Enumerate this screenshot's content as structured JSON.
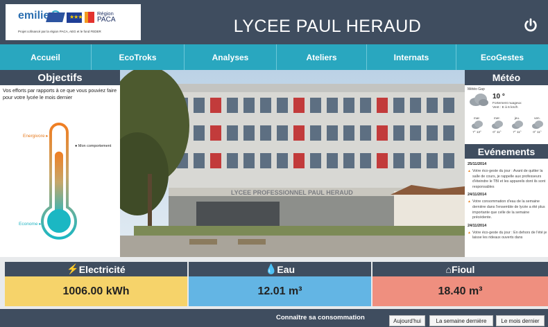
{
  "header": {
    "logo_emilie": "emilie",
    "logo_region_line1": "Région",
    "logo_region_line2": "PACA",
    "logo_caption": "Projet cofinancé par la région PACA, AEG et le fond FEDER",
    "title": "LYCEE PAUL HERAUD",
    "power_icon": "power-icon"
  },
  "nav": {
    "items": [
      "Accueil",
      "EcoTroks",
      "Analyses",
      "Ateliers",
      "Internats",
      "EcoGestes"
    ]
  },
  "objectifs": {
    "title": "Objectifs",
    "text": "Vos efforts par rapports à ce que vous pouviez faire pour votre lycée le mois dernier",
    "label_energivore": "Energivore",
    "label_econome": "Econome",
    "marker_label": "Mon comportement",
    "thermo_fill": 0.78
  },
  "meteo": {
    "title": "Météo",
    "location": "Météo Gap",
    "temp": "10 °",
    "desc_line1": "Fortement nuageux",
    "desc_line2": "Vent : E à 6 km/h",
    "forecast": [
      {
        "day": "mar.",
        "temps": "7° 13°"
      },
      {
        "day": "mer.",
        "temps": "0° 11°"
      },
      {
        "day": "jeu.",
        "temps": "7° 11°"
      },
      {
        "day": "ven.",
        "temps": "0° 11°"
      }
    ]
  },
  "events": {
    "title": "Evénements",
    "items": [
      {
        "date": "25/11/2014",
        "text": "Votre éco-geste du jour : Avant de quitter la salle de cours, je rappelle aux professeurs d'éteindre le TBI et les appareils dont ils sont responsables"
      },
      {
        "date": "24/11/2014",
        "text": "Votre consommation d'eau de la semaine dernière dans l'ensemble de lycée a été plus importante que celle de la semaine précédente."
      },
      {
        "date": "24/11/2014",
        "text": "Votre éco-geste du jour : En dehors de l'été je laisse les rideaux ouverts dans"
      }
    ]
  },
  "photo": {
    "sign": "LYCEE PROFESSIONNEL PAUL HERAUD"
  },
  "consumption": {
    "electricity": {
      "label": "Electricité",
      "value": "1006.00 kWh",
      "color": "#f6d36a"
    },
    "water": {
      "label": "Eau",
      "value": "12.01 m³",
      "color": "#63b5e4"
    },
    "fuel": {
      "label": "Fioul",
      "value": "18.40 m³",
      "color": "#ef8f7f"
    }
  },
  "footer": {
    "label": "Connaître sa consommation",
    "buttons": [
      "Aujourd'hui",
      "La semaine dernière",
      "Le mois dernier"
    ]
  }
}
